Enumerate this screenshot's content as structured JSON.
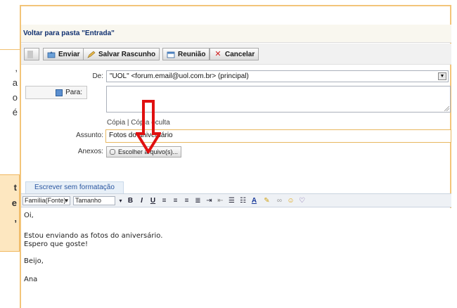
{
  "left_partial": {
    "lines": [
      ",",
      "a",
      "o",
      "é"
    ],
    "tip_lines": [
      "t",
      "e",
      ","
    ]
  },
  "back_link": "Voltar para pasta \"Entrada\"",
  "toolbar": {
    "send": "Enviar",
    "save_draft": "Salvar Rascunho",
    "meeting": "Reunião",
    "cancel": "Cancelar"
  },
  "form": {
    "from_label": "De:",
    "from_value": "\"UOL\" <forum.email@uol.com.br> (principal)",
    "to_label": "Para:",
    "to_value": "",
    "cc_links": "Cópia | Cópia oculta",
    "subject_label": "Assunto:",
    "subject_value": "Fotos do aniversário",
    "attach_label": "Anexos:",
    "attach_button": "Escolher arquivo(s)..."
  },
  "editor": {
    "plain_tab": "Escrever sem formatação",
    "font_family": "Família(Fonte)",
    "font_size": "Tamanho",
    "format_icons": [
      "B",
      "I",
      "U"
    ],
    "body_lines": [
      "Oi,",
      "",
      "Estou enviando as fotos do aniversário.",
      "Espero que goste!",
      "",
      "Beijo,",
      "",
      "Ana"
    ]
  },
  "colors": {
    "frame_border": "#f3c57a",
    "annotation_red": "#e01010"
  }
}
